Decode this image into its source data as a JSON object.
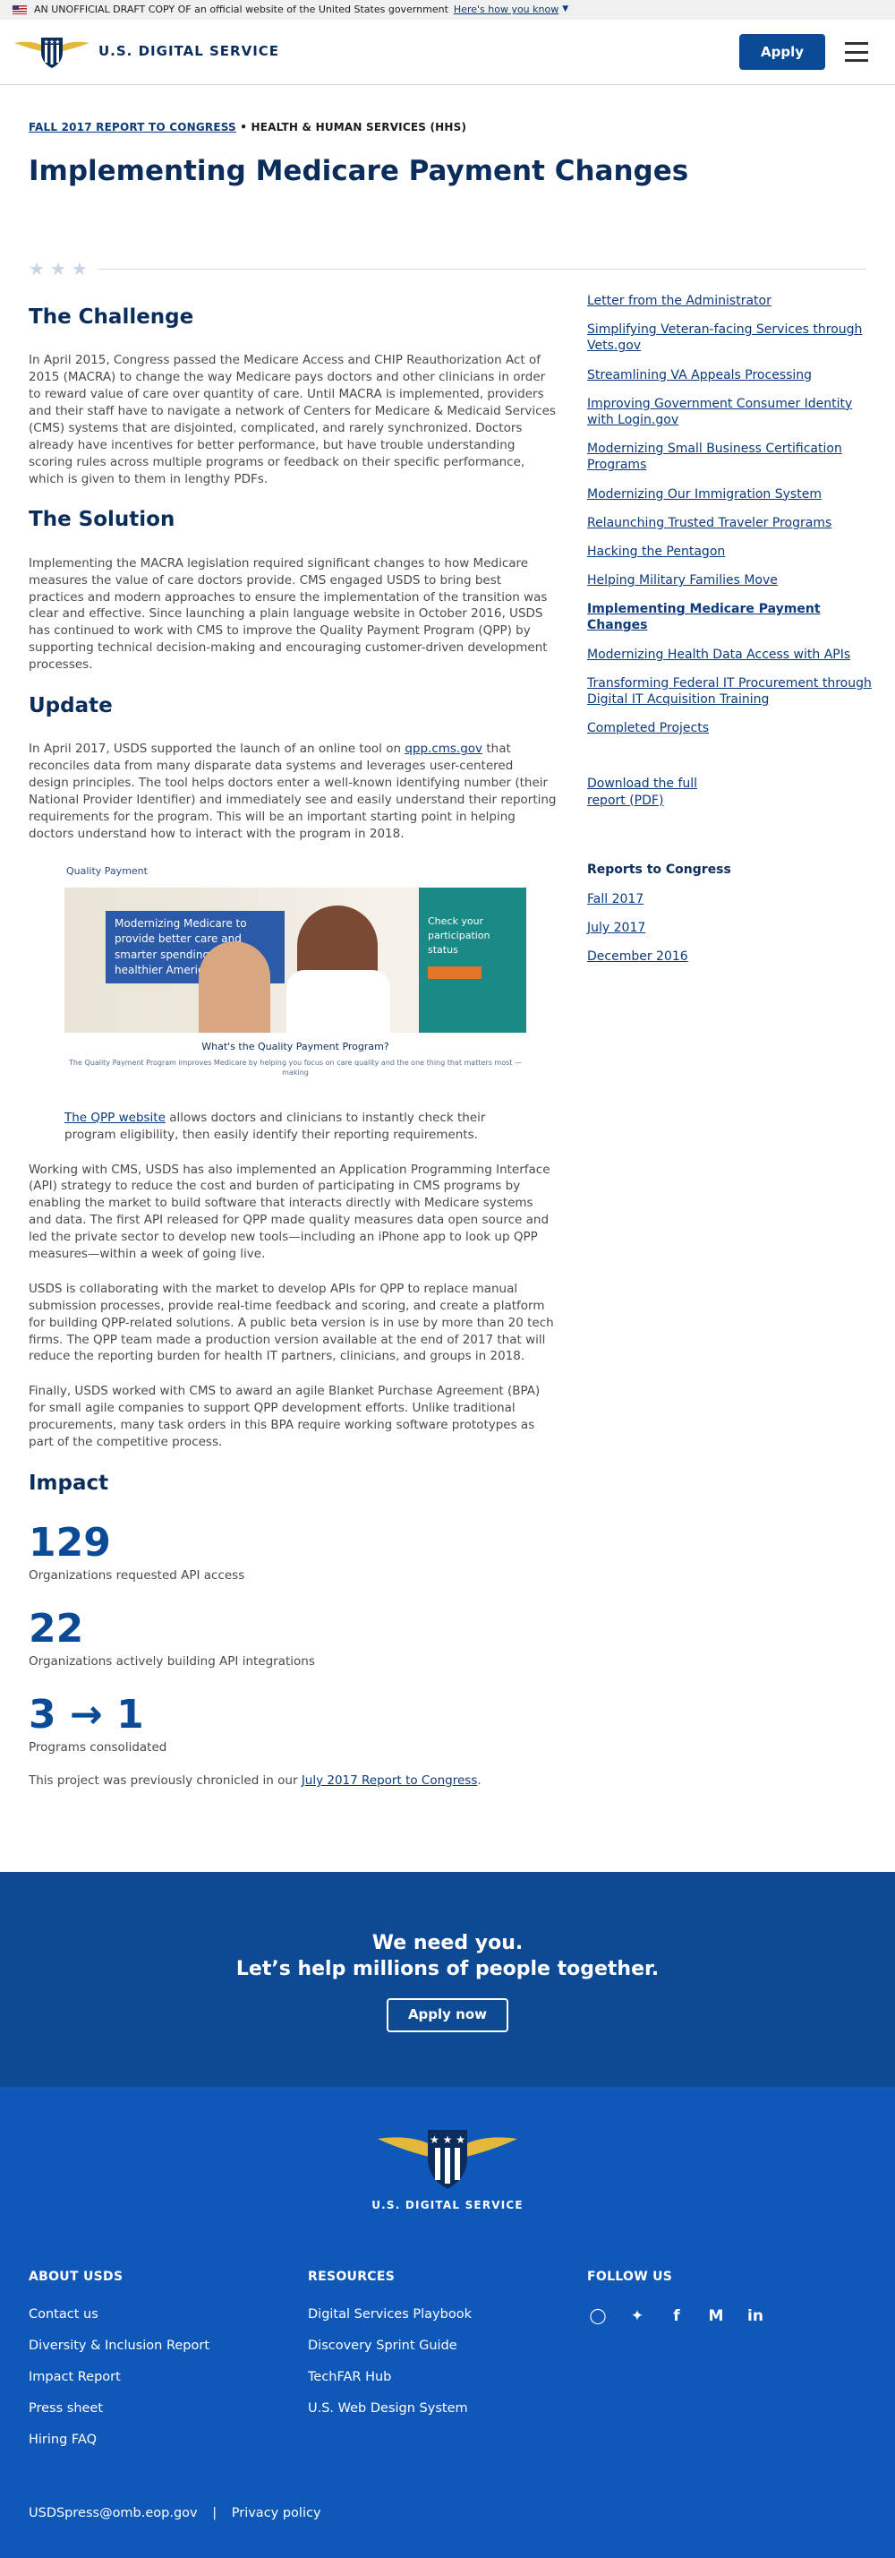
{
  "banner": {
    "text": "AN UNOFFICIAL DRAFT COPY OF an official website of the United States government",
    "how": "Here's how you know"
  },
  "header": {
    "logo_text": "U.S. DIGITAL SERVICE",
    "apply": "Apply"
  },
  "eyebrow": {
    "report": "FALL 2017 REPORT TO CONGRESS",
    "sep": " • ",
    "agency": "HEALTH & HUMAN SERVICES (HHS)"
  },
  "title": "Implementing Medicare Payment Changes",
  "stars": [
    "★",
    "★",
    "★"
  ],
  "sections": {
    "challenge": {
      "heading": "The Challenge",
      "body": "In April 2015, Congress passed the Medicare Access and CHIP Reauthorization Act of 2015 (MACRA) to change the way Medicare pays doctors and other clinicians in order to reward value of care over quantity of care. Until MACRA is implemented, providers and their staff have to navigate a network of Centers for Medicare & Medicaid Services (CMS) systems that are disjointed, complicated, and rarely synchronized. Doctors already have incentives for better performance, but have trouble understanding scoring rules across multiple programs or feedback on their specific performance, which is given to them in lengthy PDFs."
    },
    "solution": {
      "heading": "The Solution",
      "body": "Implementing the MACRA legislation required significant changes to how Medicare measures the value of care doctors provide. CMS engaged USDS to bring best practices and modern approaches to ensure the implementation of the transition was clear and effective. Since launching a plain language website in October 2016, USDS has continued to work with CMS to improve the Quality Payment Program (QPP) by supporting technical decision-making and encouraging customer-driven development processes."
    },
    "update": {
      "heading": "Update",
      "p1_before": "In April 2017, USDS supported the launch of an online tool on ",
      "p1_link": "qpp.cms.gov",
      "p1_after": " that reconciles data from many disparate data systems and leverages user-centered design principles. The tool helps doctors enter a well-known identifying number (their National Provider Identifier) and immediately see and easily understand their reporting requirements for the program. This will be an important starting point in helping doctors understand how to interact with the program in 2018.",
      "image": {
        "brand": "Quality Payment",
        "hero_msg": "Modernizing Medicare to provide better care and smarter spending for a healthier America.",
        "panel": "Check your participation status",
        "caption_title": "What's the Quality Payment Program?",
        "caption_sub": "The Quality Payment Program improves Medicare by helping you focus on care quality and the one thing that matters most — making"
      },
      "caption_link": "The QPP website",
      "caption_rest": " allows doctors and clinicians to instantly check their program eligibility, then easily identify their reporting requirements.",
      "p2": "Working with CMS, USDS has also implemented an Application Programming Interface (API) strategy to reduce the cost and burden of participating in CMS programs by enabling the market to build software that interacts directly with Medicare systems and data. The first API released for QPP made quality measures data open source and led the private sector to develop new tools—including an iPhone app to look up QPP measures—within a week of going live.",
      "p3": "USDS is collaborating with the market to develop APIs for QPP to replace manual submission processes, provide real-time feedback and scoring, and create a platform for building QPP-related solutions. A public beta version is in use by more than 20 tech firms. The QPP team made a production version available at the end of 2017 that will reduce the reporting burden for health IT partners, clinicians, and groups in 2018.",
      "p4": "Finally, USDS worked with CMS to award an agile Blanket Purchase Agreement (BPA) for small agile companies to support QPP development efforts. Unlike traditional procurements, many task orders in this BPA require working software prototypes as part of the competitive process."
    },
    "impact": {
      "heading": "Impact",
      "stats": [
        {
          "num": "129",
          "label": "Organizations requested API access"
        },
        {
          "num": "22",
          "label": "Organizations actively building API integrations"
        },
        {
          "num": "3 → 1",
          "label": "Programs consolidated"
        }
      ],
      "chronicle_before": "This project was previously chronicled in our ",
      "chronicle_link": "July 2017 Report to Congress",
      "chronicle_after": "."
    }
  },
  "sidebar": {
    "links": [
      "Letter from the Administrator",
      "Simplifying Veteran-facing Services through Vets.gov",
      "Streamlining VA Appeals Processing",
      "Improving Government Consumer Identity with Login.gov",
      "Modernizing Small Business Certification Programs",
      "Modernizing Our Immigration System",
      "Relaunching Trusted Traveler Programs",
      "Hacking the Pentagon",
      "Helping Military Families Move",
      "Implementing Medicare Payment Changes",
      "Modernizing Health Data Access with APIs",
      "Transforming Federal IT Procurement through Digital IT Acquisition Training",
      "Completed Projects"
    ],
    "active_index": 9,
    "download": "Download the full report (PDF)",
    "reports_heading": "Reports to Congress",
    "reports": [
      "Fall 2017",
      "July 2017",
      "December 2016"
    ]
  },
  "cta": {
    "line1": "We need you.",
    "line2": "Let’s help millions of people together.",
    "button": "Apply now"
  },
  "footer": {
    "logo_text": "U.S. DIGITAL SERVICE",
    "about": {
      "heading": "ABOUT USDS",
      "links": [
        "Contact us",
        "Diversity & Inclusion Report",
        "Impact Report",
        "Press sheet",
        "Hiring FAQ"
      ]
    },
    "resources": {
      "heading": "RESOURCES",
      "links": [
        "Digital Services Playbook",
        "Discovery Sprint Guide",
        "TechFAR Hub",
        "U.S. Web Design System"
      ]
    },
    "follow": {
      "heading": "FOLLOW US",
      "icons": [
        "instagram-icon",
        "twitter-icon",
        "facebook-icon",
        "medium-icon",
        "linkedin-icon"
      ]
    },
    "email": "USDSpress@omb.eop.gov",
    "sep": "|",
    "privacy": "Privacy policy"
  },
  "colors": {
    "navy": "#0b2d5c",
    "blue": "#0b4a94",
    "cta_bg": "#0e4a93",
    "footer_bg": "#0f58b8",
    "teal": "#1a8a86"
  }
}
